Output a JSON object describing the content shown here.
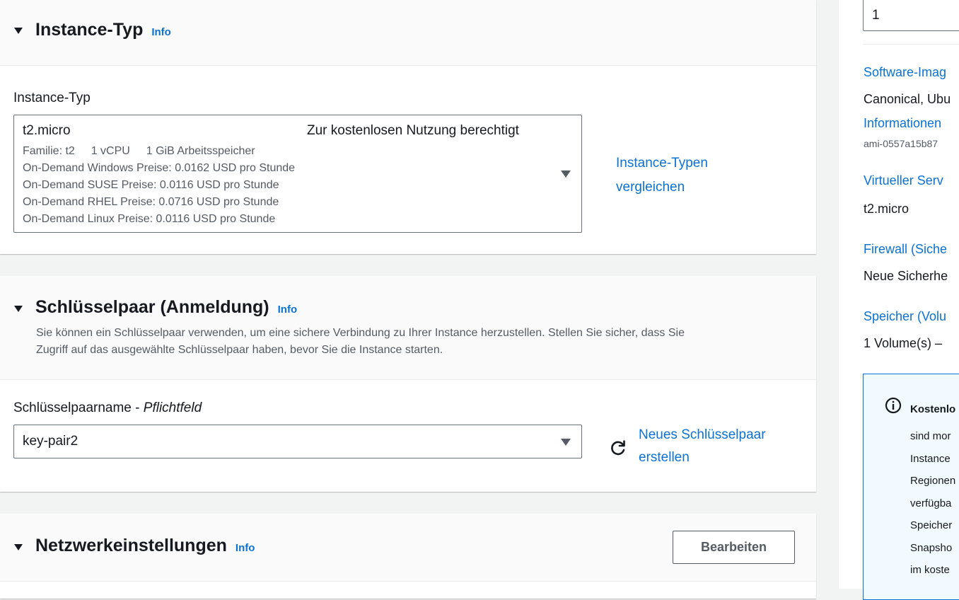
{
  "instance_type_section": {
    "title": "Instance-Typ",
    "info": "Info",
    "field_label": "Instance-Typ",
    "selected": {
      "name": "t2.micro",
      "free_tier": "Zur kostenlosen Nutzung berechtigt",
      "family": "Familie: t2",
      "vcpu": "1 vCPU",
      "memory": "1 GiB Arbeitsspeicher",
      "prices": [
        "On-Demand Windows Preise: 0.0162 USD pro Stunde",
        "On-Demand SUSE Preise: 0.0116 USD pro Stunde",
        "On-Demand RHEL Preise: 0.0716 USD pro Stunde",
        "On-Demand Linux Preise: 0.0116 USD pro Stunde"
      ]
    },
    "compare_link": [
      "Instance-Typen",
      "vergleichen"
    ]
  },
  "key_pair_section": {
    "title": "Schlüsselpaar (Anmeldung)",
    "info": "Info",
    "description": [
      "Sie können ein Schlüsselpaar verwenden, um eine sichere Verbindung zu Ihrer Instance herzustellen. Stellen Sie sicher, dass Sie",
      "Zugriff auf das ausgewählte Schlüsselpaar haben, bevor Sie die Instance starten."
    ],
    "field_label": "Schlüsselpaarname - ",
    "field_required": "Pflichtfeld",
    "selected": "key-pair2",
    "create_link": [
      "Neues Schlüsselpaar",
      "erstellen"
    ]
  },
  "network_section": {
    "title": "Netzwerkeinstellungen",
    "info": "Info",
    "edit_button": "Bearbeiten"
  },
  "summary": {
    "count_value": "1",
    "software_image_label": "Software-Imag",
    "software_image_value": "Canonical, Ubu",
    "software_image_link": "Informationen",
    "ami_id": "ami-0557a15b87",
    "virtual_server_label": "Virtueller Serv",
    "virtual_server_value": "t2.micro",
    "firewall_label": "Firewall (Siche",
    "firewall_value": "Neue Sicherhe",
    "storage_label": "Speicher (Volu",
    "storage_value": "1 Volume(s) – ",
    "free_tier_box": {
      "title": "Kostenlo",
      "lines": [
        "sind mor",
        "Instance",
        "Regionen",
        "verfügba",
        "Speicher",
        "Snapsho",
        "im koste"
      ]
    }
  }
}
